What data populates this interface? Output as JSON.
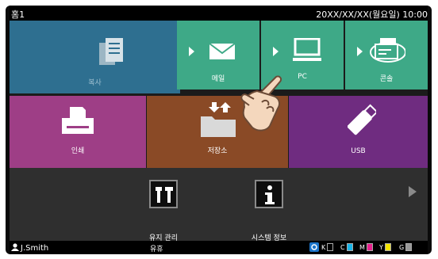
{
  "status": {
    "home_label": "홈1",
    "datetime": "20XX/XX/XX(월요일) 10:00"
  },
  "tiles": {
    "copy": "복사",
    "print": "인쇄",
    "storage": "저장소",
    "usb": "USB"
  },
  "scan_menu": {
    "mail": "메일",
    "pc": "PC",
    "console": "콘솔"
  },
  "tools": {
    "maintenance": "유지 관리",
    "system_info": "시스템 정보"
  },
  "bottom": {
    "user": "J.Smith",
    "state": "유휴",
    "ink": [
      {
        "letter": "K",
        "color": "#000000"
      },
      {
        "letter": "C",
        "color": "#19b5e8"
      },
      {
        "letter": "M",
        "color": "#e8218c"
      },
      {
        "letter": "Y",
        "color": "#f3e500"
      },
      {
        "letter": "G",
        "color": "#9a9a9a"
      }
    ]
  },
  "colors": {
    "copy_tile": "#2e6f90",
    "scan_tile": "#3ea987",
    "print_tile": "#9e3e86",
    "storage_tile": "#8a4a26",
    "usb_tile": "#6f2c80"
  }
}
